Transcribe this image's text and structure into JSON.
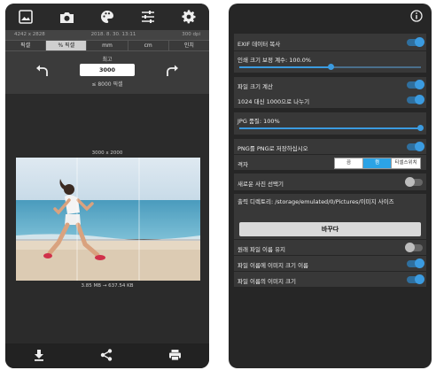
{
  "left": {
    "info": {
      "resolution": "4242 x 2828",
      "datetime": "2018. 8. 30. 13:11",
      "dpi": "300 dpi"
    },
    "unit_tabs": [
      {
        "label": "픽셀",
        "active": false
      },
      {
        "label": "% 픽셀",
        "active": true
      },
      {
        "label": "mm",
        "active": false
      },
      {
        "label": "cm",
        "active": false
      },
      {
        "label": "인치",
        "active": false
      }
    ],
    "resize": {
      "label": "최고",
      "value": "3000",
      "caption": "≤ 8000 픽셀"
    },
    "canvas": {
      "dimensions": "3000 x 2000",
      "size_change": "3.85 MB → 637.54 KB"
    },
    "icons": {
      "toolbar": [
        "gallery-icon",
        "camera-icon",
        "palette-icon",
        "sliders-icon",
        "gear-icon"
      ],
      "bottom": [
        "download-icon",
        "share-icon",
        "print-icon"
      ]
    }
  },
  "right": {
    "exif": {
      "label": "EXIF 데이터 복사",
      "on": true
    },
    "print_correction": {
      "label": "인쇄 크기 보정 계수: 100.0%",
      "value": 0.5
    },
    "file_size": {
      "label": "파일 크기 계산",
      "on": true
    },
    "divide_1000": {
      "label": "1024 대신 1000으로 나누기",
      "on": true
    },
    "jpg_quality": {
      "label": "JPG 품질: 100%",
      "value": 1.0
    },
    "png_save": {
      "label": "PNG를 PNG로 저장하십시오",
      "on": true
    },
    "grid": {
      "label": "격자",
      "options": [
        "끔",
        "켬",
        "티셀스위치"
      ],
      "active": 1
    },
    "select_new": {
      "label": "새로운 사진 선택기",
      "on": false
    },
    "output_dir": {
      "label": "출력 디렉토리: /storage/emulated/0/Pictures/이미지 사이즈",
      "button": "바꾸다"
    },
    "keep_name": {
      "label": "원래 파일 이름 유지",
      "on": false
    },
    "name_size": {
      "label": "파일 이름에 이미지 크기 이름",
      "on": true
    },
    "name_image_size": {
      "label": "파일 이름의 이미지 크기",
      "on": true
    },
    "colors": {
      "accent": "#3b9be0",
      "panel": "#383838",
      "background": "#262626"
    }
  }
}
